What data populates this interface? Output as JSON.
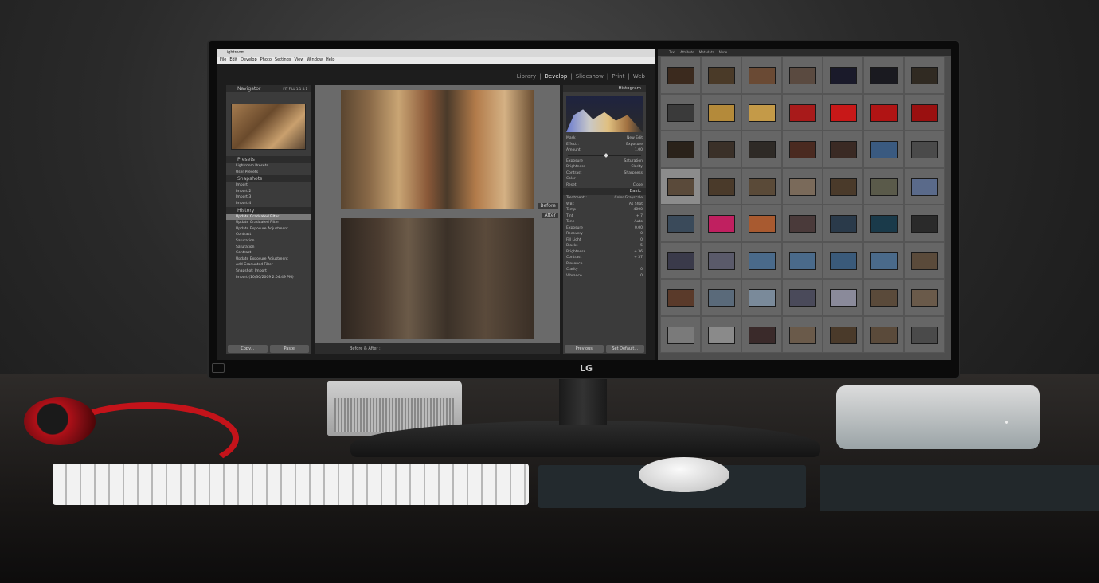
{
  "scene": {
    "monitor_brand": "LG"
  },
  "app": {
    "title": "Lightroom",
    "menu": [
      "File",
      "Edit",
      "Develop",
      "Photo",
      "Settings",
      "View",
      "Window",
      "Help"
    ],
    "modules": [
      "Library",
      "Develop",
      "Slideshow",
      "Print",
      "Web"
    ],
    "active_module": "Develop",
    "left_panel": {
      "navigator": "Navigator",
      "navigator_zoom": [
        "FIT",
        "FILL",
        "1:1",
        "4:1"
      ],
      "presets_header": "Presets",
      "presets": [
        "Lightroom Presets",
        "User Presets"
      ],
      "snapshots_header": "Snapshots",
      "snapshots": [
        "Import",
        "Import 2",
        "Import 3",
        "Import 4"
      ],
      "history_header": "History",
      "history": [
        "Update Graduated Filter",
        "Update Graduated Filter",
        "Update Exposure Adjustment",
        "Contrast",
        "Saturation",
        "Saturation",
        "Contrast",
        "Update Exposure Adjustment",
        "Add Graduated Filter",
        "Snapshot: Import",
        "Import (10/30/2009 2:04:49 PM)"
      ],
      "copy": "Copy...",
      "paste": "Paste"
    },
    "center": {
      "before_label": "Before",
      "after_label": "After",
      "view_mode": "Before & After :"
    },
    "right_panel": {
      "histogram": "Histogram",
      "mask": "Mask :",
      "mask_new": "New",
      "mask_edit": "Edit",
      "effect": "Effect :",
      "effect_value": "Exposure",
      "amount": "Amount",
      "amount_value": "1.00",
      "local_controls": [
        [
          "Exposure",
          "Saturation"
        ],
        [
          "Brightness",
          "Clarity"
        ],
        [
          "Contrast",
          "Sharpness"
        ]
      ],
      "color": "Color",
      "reset": "Reset",
      "close": "Close",
      "basic": "Basic",
      "treatment": "Treatment :",
      "treatment_color": "Color",
      "treatment_gray": "Grayscale",
      "wb": "WB :",
      "wb_value": "As Shot",
      "temp": "Temp",
      "temp_value": "4000",
      "tint": "Tint",
      "tint_value": "+ 7",
      "tone": "Tone",
      "auto": "Auto",
      "exposure": "Exposure",
      "exposure_value": "0.00",
      "recovery": "Recovery",
      "recovery_value": "0",
      "fill_light": "Fill Light",
      "fill_value": "0",
      "blacks": "Blacks",
      "blacks_value": "5",
      "brightness": "Brightness",
      "brightness_value": "+ 36",
      "contrast": "Contrast",
      "contrast_value": "+ 37",
      "presence": "Presence",
      "clarity": "Clarity",
      "clarity_value": "0",
      "vibrance": "Vibrance",
      "vibrance_value": "0",
      "previous": "Previous",
      "set_default": "Set Default..."
    }
  },
  "grid": {
    "tabs": [
      "Text",
      "Attribute",
      "Metadata",
      "None"
    ],
    "thumbnail_colors": [
      "#3b2a1e",
      "#4a3a28",
      "#6a4a34",
      "#5a4a40",
      "#1a1a2a",
      "#1a1a20",
      "#302a22",
      "#3a3a3a",
      "#b48a3a",
      "#c49a48",
      "#a81a1a",
      "#c81818",
      "#b01414",
      "#9a1010",
      "#2a221a",
      "#3a3028",
      "#2e2a26",
      "#4a2a20",
      "#3a2a24",
      "#3a5a80",
      "#4a4a4a",
      "#5a4a3a",
      "#4a3a2a",
      "#5a4a38",
      "#7a6a5a",
      "#4a3a2a",
      "#5a5a4a",
      "#5a6a8a",
      "#3a4a5a",
      "#c02060",
      "#a85a30",
      "#4a3a3a",
      "#2a3a4a",
      "#1a3a4a",
      "#2a2a2a",
      "#3a3a4a",
      "#5a5a6a",
      "#4a6a8a",
      "#4a6a8a",
      "#3a5a7a",
      "#4a6a8a",
      "#5a4a3a",
      "#5a3a2a",
      "#5a6a7a",
      "#7a8a9a",
      "#4a4a5a",
      "#8a8a9a",
      "#5a4a3a",
      "#6a5a4a",
      "#7a7a7a",
      "#8a8a8a",
      "#3a2a2a",
      "#6a5a4a",
      "#4a3a2a",
      "#5a4a3a",
      "#4a4a4a"
    ]
  }
}
